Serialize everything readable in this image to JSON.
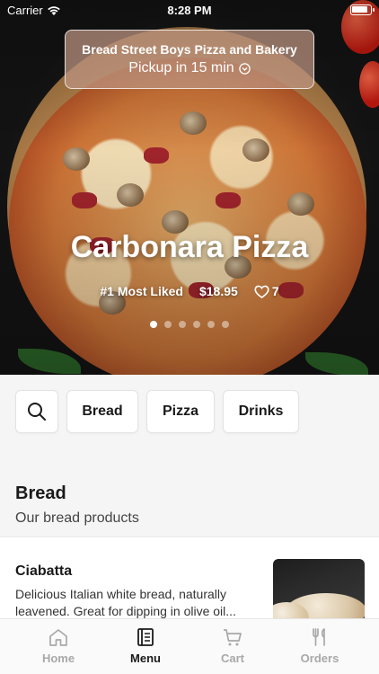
{
  "status_bar": {
    "carrier": "Carrier",
    "time": "8:28 PM"
  },
  "restaurant": {
    "name": "Bread Street Boys Pizza and Bakery",
    "pickup": "Pickup in 15 min"
  },
  "featured": {
    "title": "Carbonara Pizza",
    "badge": "#1 Most Liked",
    "price": "$18.95",
    "likes": "7",
    "slide_count": 6,
    "active_slide": 1
  },
  "categories": {
    "search_icon": "search-icon",
    "items": [
      "Bread",
      "Pizza",
      "Drinks"
    ]
  },
  "section": {
    "title": "Bread",
    "subtitle": "Our bread products"
  },
  "menu_item": {
    "name": "Ciabatta",
    "description": "Delicious Italian white bread, naturally leavened. Great for dipping in olive oil..."
  },
  "tabs": [
    {
      "label": "Home",
      "icon": "home-icon",
      "active": false
    },
    {
      "label": "Menu",
      "icon": "menu-book-icon",
      "active": true
    },
    {
      "label": "Cart",
      "icon": "cart-icon",
      "active": false
    },
    {
      "label": "Orders",
      "icon": "fork-knife-icon",
      "active": false
    }
  ],
  "colors": {
    "active_tab": "#1a1a1a",
    "inactive_tab": "#a8a8a8",
    "accent_tomato": "#d8261a"
  }
}
